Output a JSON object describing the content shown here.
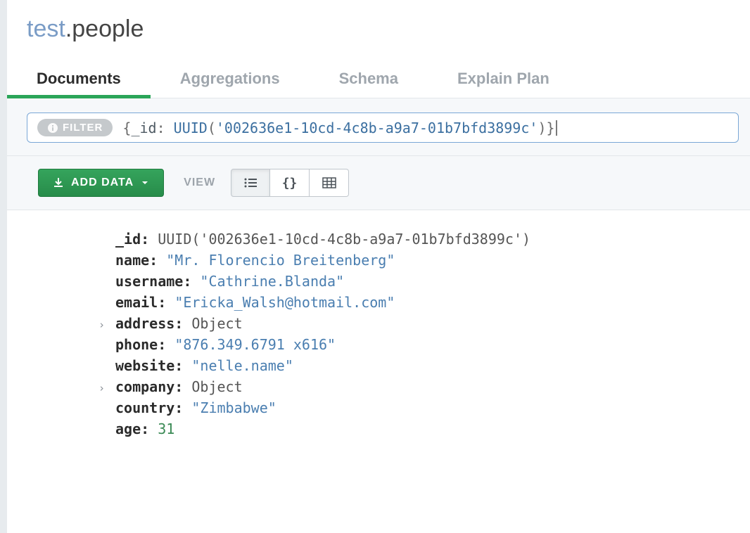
{
  "title": {
    "database": "test",
    "collection": ".people"
  },
  "tabs": [
    {
      "label": "Documents",
      "active": true
    },
    {
      "label": "Aggregations",
      "active": false
    },
    {
      "label": "Schema",
      "active": false
    },
    {
      "label": "Explain Plan",
      "active": false
    }
  ],
  "filter": {
    "pill_label": "FILTER",
    "open": "{",
    "key": "_id",
    "sep": ": ",
    "fn": "UUID",
    "open_paren": "(",
    "str": "'002636e1-10cd-4c8b-a9a7-01b7bfd3899c'",
    "close_paren": ")",
    "close": "}"
  },
  "toolbar": {
    "add_label": "ADD DATA",
    "view_label": "VIEW"
  },
  "document": {
    "fields": [
      {
        "key": "_id",
        "value": "UUID('002636e1-10cd-4c8b-a9a7-01b7bfd3899c')",
        "type": "plain",
        "expandable": false
      },
      {
        "key": "name",
        "value": "\"Mr. Florencio Breitenberg\"",
        "type": "string",
        "expandable": false
      },
      {
        "key": "username",
        "value": "\"Cathrine.Blanda\"",
        "type": "string",
        "expandable": false
      },
      {
        "key": "email",
        "value": "\"Ericka_Walsh@hotmail.com\"",
        "type": "string",
        "expandable": false
      },
      {
        "key": "address",
        "value": "Object",
        "type": "plain",
        "expandable": true
      },
      {
        "key": "phone",
        "value": "\"876.349.6791 x616\"",
        "type": "string",
        "expandable": false
      },
      {
        "key": "website",
        "value": "\"nelle.name\"",
        "type": "string",
        "expandable": false
      },
      {
        "key": "company",
        "value": "Object",
        "type": "plain",
        "expandable": true
      },
      {
        "key": "country",
        "value": "\"Zimbabwe\"",
        "type": "string",
        "expandable": false
      },
      {
        "key": "age",
        "value": "31",
        "type": "number",
        "expandable": false
      }
    ]
  }
}
